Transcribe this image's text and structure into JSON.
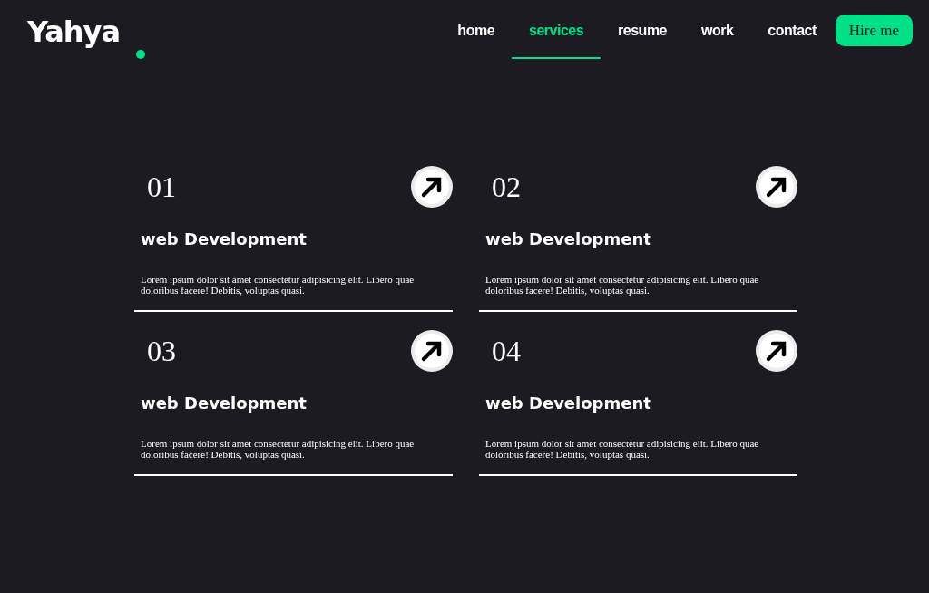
{
  "logo": "Yahya",
  "nav": [
    {
      "label": "home",
      "selected": false
    },
    {
      "label": "services",
      "selected": true
    },
    {
      "label": "resume",
      "selected": false
    },
    {
      "label": "work",
      "selected": false
    },
    {
      "label": "contact",
      "selected": false
    }
  ],
  "hire_button": "Hire me",
  "services": [
    {
      "number": "01",
      "title": "web Development",
      "description": "Lorem ipsum dolor sit amet consectetur adipisicing elit. Libero quae doloribus facere! Debitis, voluptas quasi."
    },
    {
      "number": "02",
      "title": "web Development",
      "description": "Lorem ipsum dolor sit amet consectetur adipisicing elit. Libero quae doloribus facere! Debitis, voluptas quasi."
    },
    {
      "number": "03",
      "title": "web Development",
      "description": "Lorem ipsum dolor sit amet consectetur adipisicing elit. Libero quae doloribus facere! Debitis, voluptas quasi."
    },
    {
      "number": "04",
      "title": "web Development",
      "description": "Lorem ipsum dolor sit amet consectetur adipisicing elit. Libero quae doloribus facere! Debitis, voluptas quasi."
    }
  ]
}
